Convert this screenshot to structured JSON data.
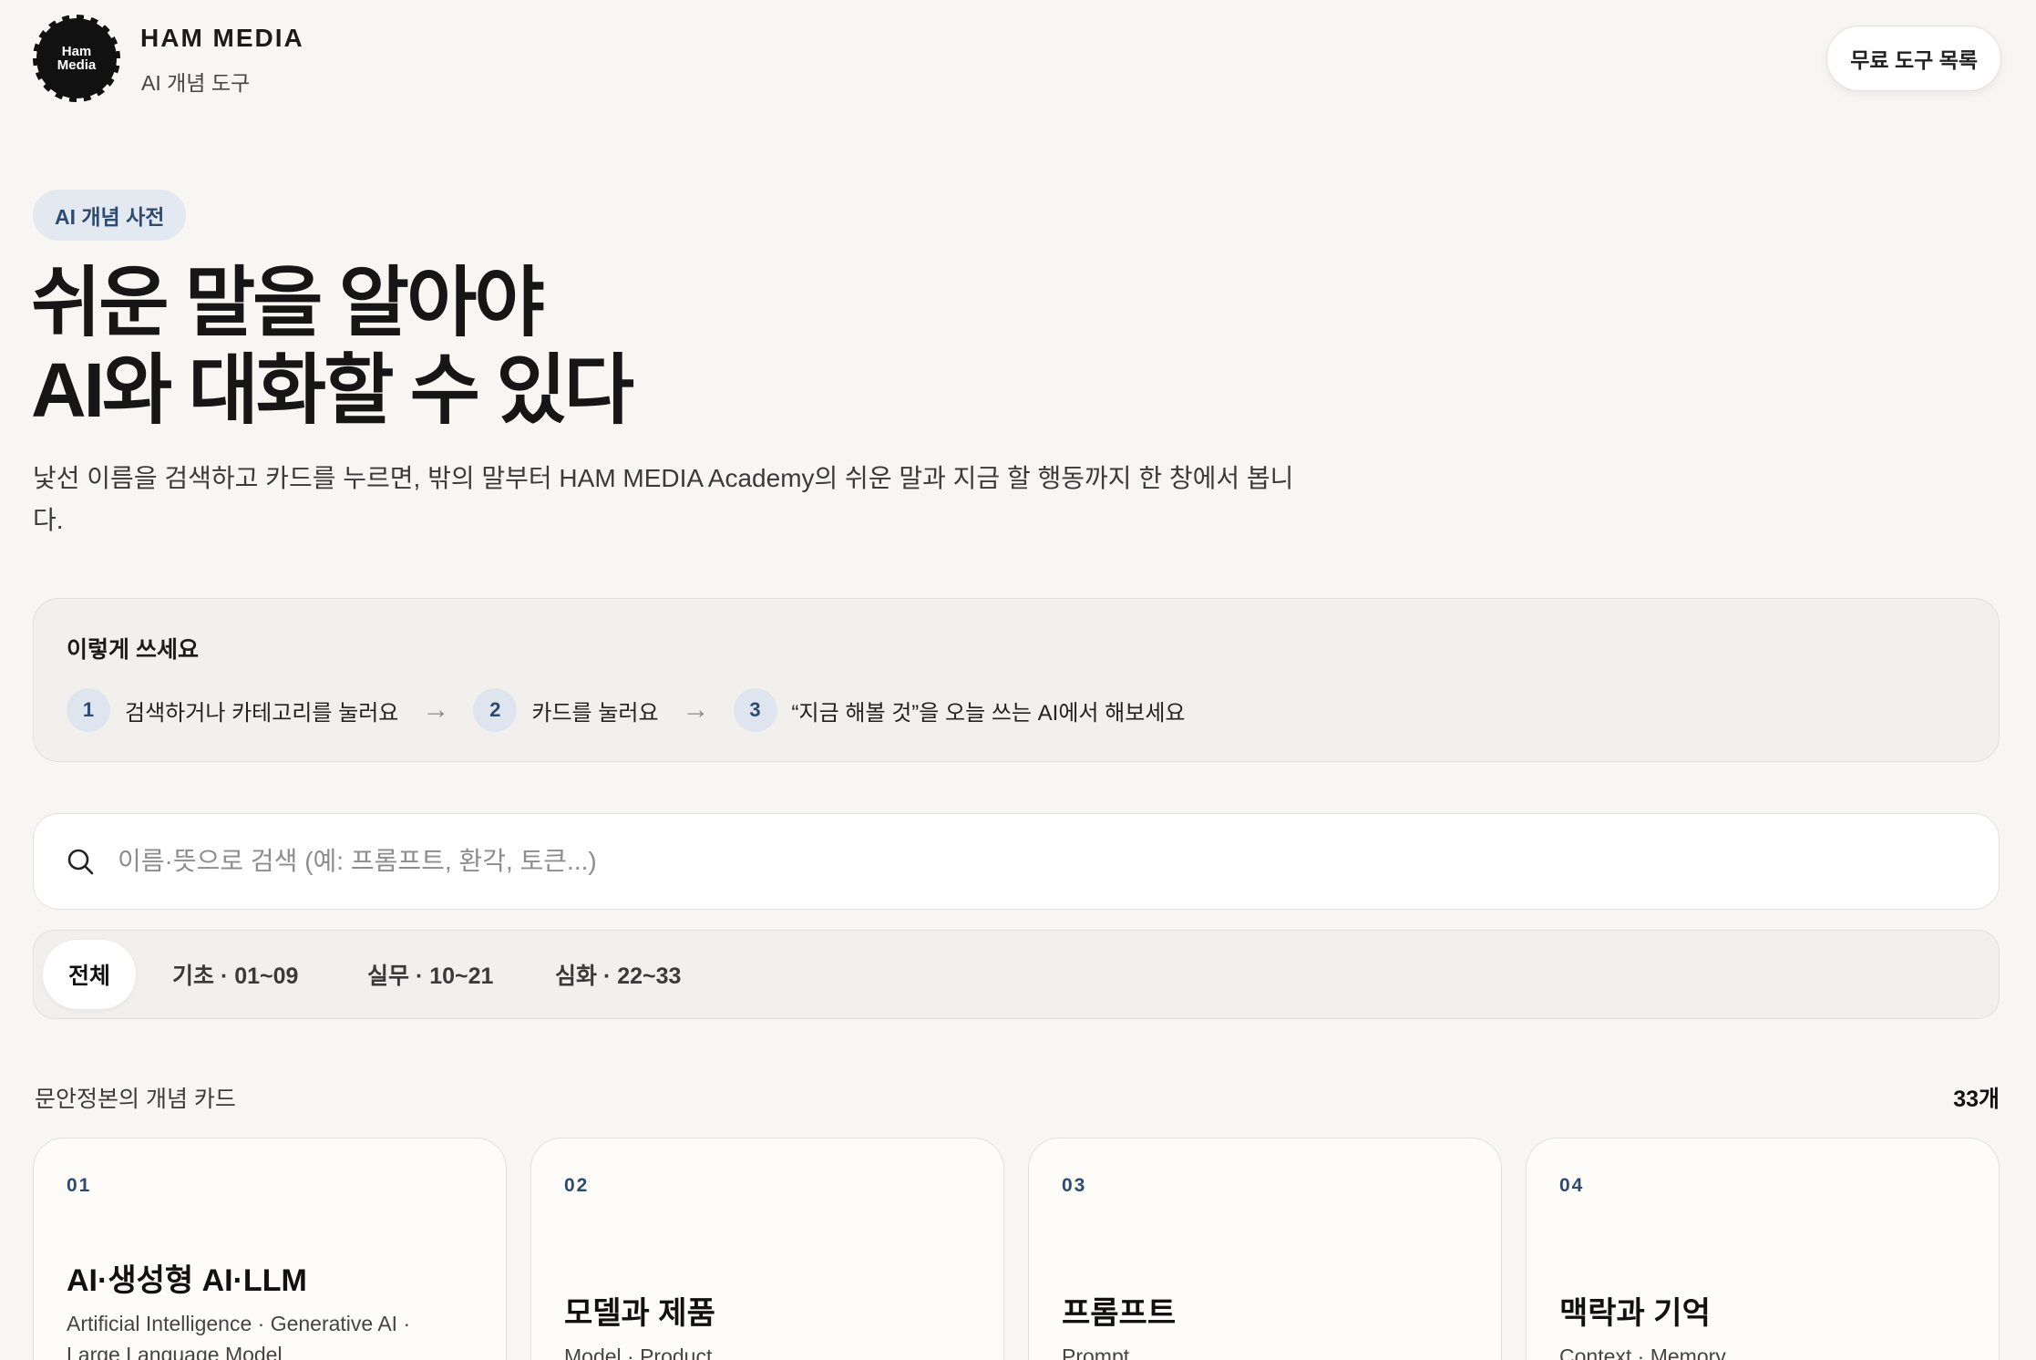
{
  "header": {
    "logo_text": "Ham\nMedia",
    "brand_name": "HAM MEDIA",
    "brand_sub": "AI 개념 도구",
    "tools_button": "무료 도구 목록"
  },
  "hero": {
    "pill": "AI 개념 사전",
    "title_line1": "쉬운 말을 알아야",
    "title_line2": "AI와 대화할 수 있다",
    "description": "낯선 이름을 검색하고 카드를 누르면, 밖의 말부터 HAM MEDIA Academy의 쉬운 말과 지금 할 행동까지 한 창에서 봅니다."
  },
  "guide": {
    "title": "이렇게 쓰세요",
    "steps": [
      {
        "num": "1",
        "text": "검색하거나 카테고리를 눌러요"
      },
      {
        "num": "2",
        "text": "카드를 눌러요"
      },
      {
        "num": "3",
        "text": "“지금 해볼 것”을 오늘 쓰는 AI에서 해보세요"
      }
    ]
  },
  "search": {
    "placeholder": "이름·뜻으로 검색 (예: 프롬프트, 환각, 토큰...)",
    "value": ""
  },
  "tabs": [
    {
      "label": "전체",
      "active": true
    },
    {
      "label": "기초 · 01~09",
      "active": false
    },
    {
      "label": "실무 · 10~21",
      "active": false
    },
    {
      "label": "심화 · 22~33",
      "active": false
    }
  ],
  "list": {
    "label": "문안정본의 개념 카드",
    "count": "33개"
  },
  "cards": [
    {
      "num": "01",
      "title": "AI·생성형 AI·LLM",
      "sub": "Artificial Intelligence · Generative AI · Large Language Model"
    },
    {
      "num": "02",
      "title": "모델과 제품",
      "sub": "Model · Product"
    },
    {
      "num": "03",
      "title": "프롬프트",
      "sub": "Prompt"
    },
    {
      "num": "04",
      "title": "맥락과 기억",
      "sub": "Context · Memory"
    }
  ]
}
